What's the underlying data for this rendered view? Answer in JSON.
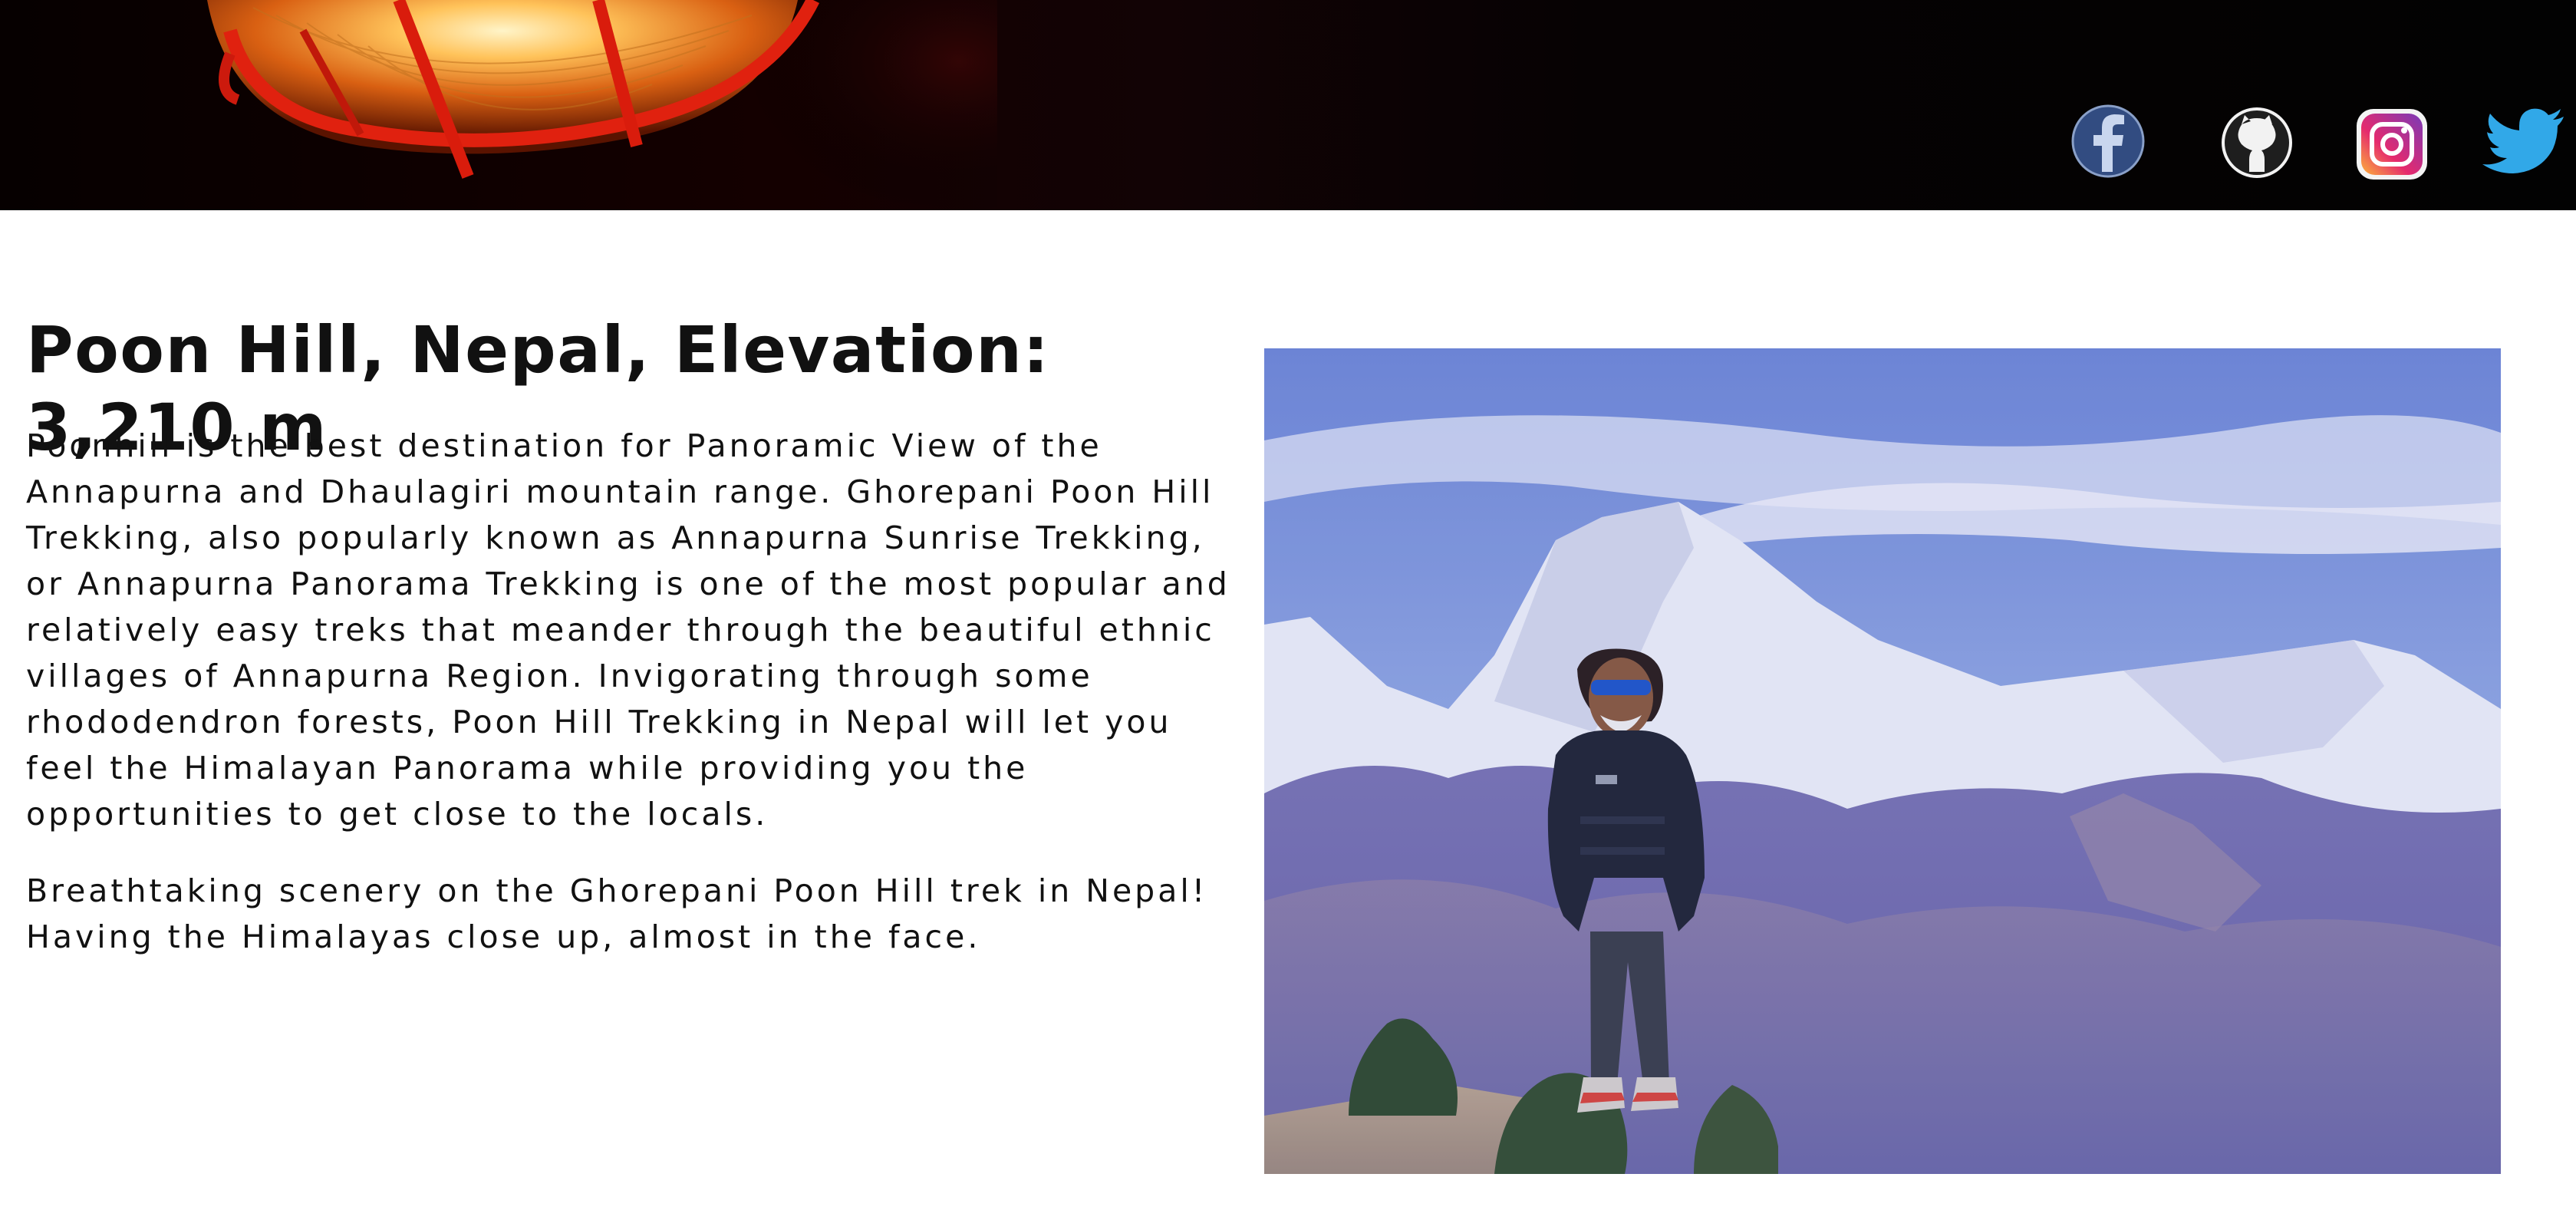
{
  "header": {
    "social": [
      {
        "name": "facebook",
        "icon": "facebook-icon",
        "color": "#3b5998"
      },
      {
        "name": "github",
        "icon": "github-icon",
        "color": "#222222"
      },
      {
        "name": "instagram",
        "icon": "instagram-icon",
        "color": "#d6249f"
      },
      {
        "name": "twitter",
        "icon": "twitter-icon",
        "color": "#1da1f2"
      }
    ]
  },
  "main": {
    "title": "Poon Hill, Nepal, Elevation: 3,210 m",
    "paragraphs": [
      "Poonhill is the best destination for Panoramic View of the Annapurna and Dhaulagiri mountain range. Ghorepani Poon Hill Trekking, also popularly known as Annapurna Sunrise Trekking, or Annapurna Panorama Trekking is one of the most popular and relatively easy treks that meander through the beautiful ethnic villages of Annapurna Region. Invigorating through some rhododendron forests, Poon Hill Trekking in Nepal will let you feel the Himalayan Panorama while providing you the opportunities to get close to the locals.",
      "Breathtaking scenery on the Ghorepani Poon Hill trek in Nepal! Having the Himalayas close up, almost in the face."
    ]
  }
}
